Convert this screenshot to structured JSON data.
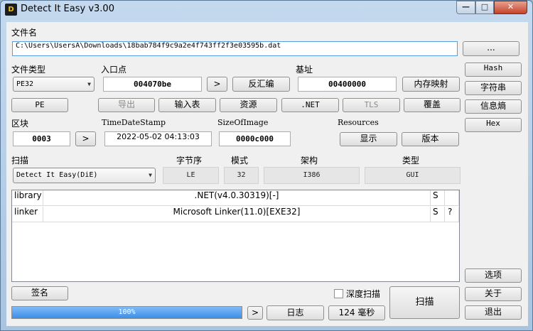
{
  "window": {
    "title": "Detect It Easy v3.00",
    "icon_text": "D"
  },
  "file": {
    "label": "文件名",
    "path": "C:\\Users\\UsersA\\Downloads\\18bab784f9c9a2e4f743ff2f3e03595b.dat",
    "browse_label": "..."
  },
  "file_type": {
    "label": "文件类型",
    "value": "PE32"
  },
  "entry_point": {
    "label": "入口点",
    "value": "004070be",
    "disasm_label": "反汇编"
  },
  "base": {
    "label": "基址",
    "value": "00400000",
    "memmap_label": "内存映射"
  },
  "side": {
    "hash": "Hash",
    "strings": "字符串",
    "entropy": "信息熵",
    "hex": "Hex",
    "options": "选项",
    "about": "关于",
    "exit": "退出"
  },
  "sections_row": {
    "pe": "PE",
    "export": "导出",
    "import": "输入表",
    "resources": "资源",
    "net": ".NET",
    "tls": "TLS",
    "overlay": "覆盖"
  },
  "sections": {
    "label": "区块",
    "value": "0003"
  },
  "timestamp": {
    "label": "TimeDateStamp",
    "value": "2022-05-02 04:13:03"
  },
  "image_size": {
    "label": "SizeOfImage",
    "value": "0000c000"
  },
  "resources": {
    "label": "Resources",
    "show_label": "显示",
    "version_label": "版本"
  },
  "scan": {
    "label": "扫描",
    "engine": "Detect It Easy(DiE)",
    "endianness_label": "字节序",
    "endianness": "LE",
    "mode_label": "模式",
    "mode": "32",
    "arch_label": "架构",
    "arch": "I386",
    "type_label": "类型",
    "type": "GUI"
  },
  "results": [
    {
      "kind": "library",
      "name": ".NET(v4.0.30319)[-]",
      "flag": "S",
      "extra": ""
    },
    {
      "kind": "linker",
      "name": "Microsoft Linker(11.0)[EXE32]",
      "flag": "S",
      "extra": "?"
    }
  ],
  "bottom": {
    "signature_label": "签名",
    "deep_scan_label": "深度扫描",
    "scan_label": "扫描",
    "progress_text": "100%",
    "progress": 1.0,
    "log_label": "日志",
    "time_text": "124 毫秒"
  }
}
